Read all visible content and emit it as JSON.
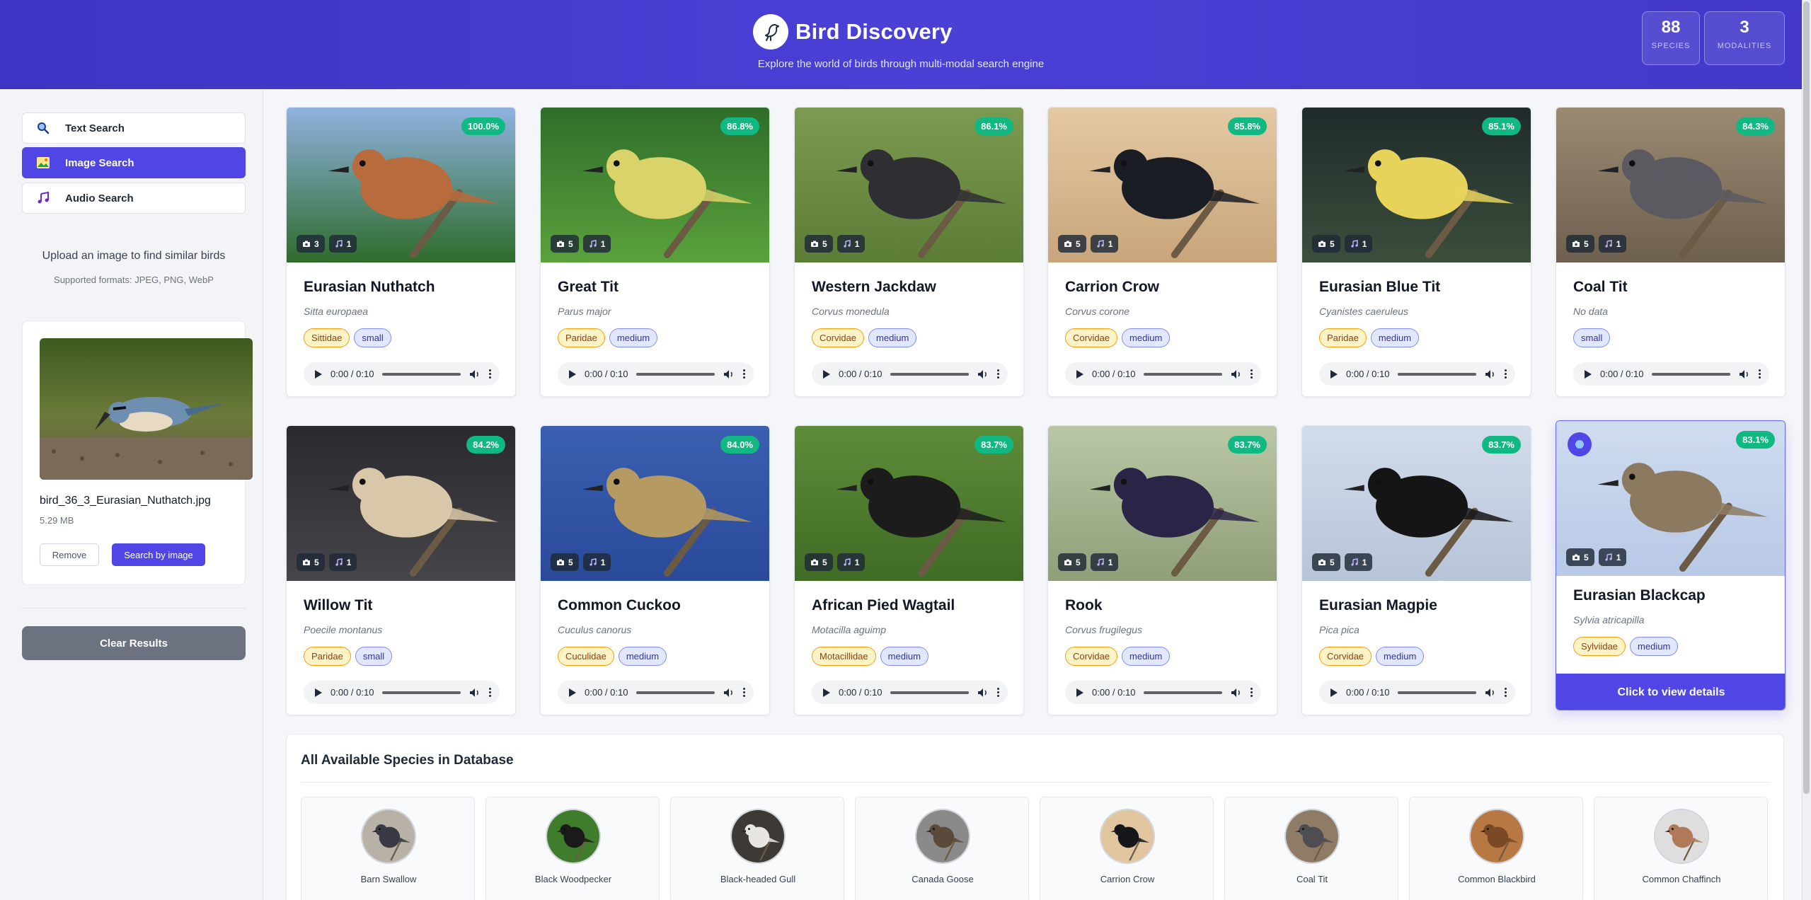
{
  "header": {
    "title": "Bird Discovery",
    "subtitle": "Explore the world of birds through multi-modal search engine",
    "stats": [
      {
        "value": "88",
        "label": "SPECIES"
      },
      {
        "value": "3",
        "label": "MODALITIES"
      }
    ]
  },
  "sidebar": {
    "modes": [
      {
        "label": "Text Search",
        "icon": "search-icon",
        "active": false
      },
      {
        "label": "Image Search",
        "icon": "image-icon",
        "active": true
      },
      {
        "label": "Audio Search",
        "icon": "music-icon",
        "active": false
      }
    ],
    "upload_hint": "Upload an image to find similar birds",
    "upload_formats": "Supported formats: JPEG, PNG, WebP",
    "file": {
      "name": "bird_36_3_Eurasian_Nuthatch.jpg",
      "size": "5.29 MB",
      "remove_label": "Remove",
      "search_label": "Search by image"
    },
    "clear_label": "Clear Results"
  },
  "results": [
    {
      "name": "Eurasian Nuthatch",
      "scientific": "Sitta europaea",
      "score": "100.0%",
      "images": "3",
      "audio": "1",
      "family": "Sittidae",
      "size": "small",
      "time": "0:00 / 0:10",
      "bg": [
        "#8fb3e0",
        "#2e6b2a"
      ],
      "bird": "#b86b3c"
    },
    {
      "name": "Great Tit",
      "scientific": "Parus major",
      "score": "86.8%",
      "images": "5",
      "audio": "1",
      "family": "Paridae",
      "size": "medium",
      "time": "0:00 / 0:10",
      "bg": [
        "#2f6d2a",
        "#5aa23c"
      ],
      "bird": "#d9d36a"
    },
    {
      "name": "Western Jackdaw",
      "scientific": "Corvus monedula",
      "score": "86.1%",
      "images": "5",
      "audio": "1",
      "family": "Corvidae",
      "size": "medium",
      "time": "0:00 / 0:10",
      "bg": [
        "#7c9a52",
        "#5c7d36"
      ],
      "bird": "#2f2f33"
    },
    {
      "name": "Carrion Crow",
      "scientific": "Corvus corone",
      "score": "85.8%",
      "images": "5",
      "audio": "1",
      "family": "Corvidae",
      "size": "medium",
      "time": "0:00 / 0:10",
      "bg": [
        "#e3c9a4",
        "#c9a57a"
      ],
      "bird": "#1b1d24"
    },
    {
      "name": "Eurasian Blue Tit",
      "scientific": "Cyanistes caeruleus",
      "score": "85.1%",
      "images": "5",
      "audio": "1",
      "family": "Paridae",
      "size": "medium",
      "time": "0:00 / 0:10",
      "bg": [
        "#1f2a2a",
        "#3b4f3c"
      ],
      "bird": "#e8d35a"
    },
    {
      "name": "Coal Tit",
      "scientific": "No data",
      "score": "84.3%",
      "images": "5",
      "audio": "1",
      "family": "",
      "size": "small",
      "time": "0:00 / 0:10",
      "bg": [
        "#9a8a72",
        "#6e604e"
      ],
      "bird": "#5a5a60"
    },
    {
      "name": "Willow Tit",
      "scientific": "Poecile montanus",
      "score": "84.2%",
      "images": "5",
      "audio": "1",
      "family": "Paridae",
      "size": "small",
      "time": "0:00 / 0:10",
      "bg": [
        "#2a2a2e",
        "#45454a"
      ],
      "bird": "#d8c7a8"
    },
    {
      "name": "Common Cuckoo",
      "scientific": "Cuculus canorus",
      "score": "84.0%",
      "images": "5",
      "audio": "1",
      "family": "Cuculidae",
      "size": "medium",
      "time": "0:00 / 0:10",
      "bg": [
        "#3b5fb0",
        "#2a4a9a"
      ],
      "bird": "#b59a62"
    },
    {
      "name": "African Pied Wagtail",
      "scientific": "Motacilla aguimp",
      "score": "83.7%",
      "images": "5",
      "audio": "1",
      "family": "Motacillidae",
      "size": "medium",
      "time": "0:00 / 0:10",
      "bg": [
        "#5f8c3a",
        "#3f6b24"
      ],
      "bird": "#1c1c1c"
    },
    {
      "name": "Rook",
      "scientific": "Corvus frugilegus",
      "score": "83.7%",
      "images": "5",
      "audio": "1",
      "family": "Corvidae",
      "size": "medium",
      "time": "0:00 / 0:10",
      "bg": [
        "#b9c7a6",
        "#8f9f78"
      ],
      "bird": "#2a2446"
    },
    {
      "name": "Eurasian Magpie",
      "scientific": "Pica pica",
      "score": "83.7%",
      "images": "5",
      "audio": "1",
      "family": "Corvidae",
      "size": "medium",
      "time": "0:00 / 0:10",
      "bg": [
        "#d2dcea",
        "#b7c4d8"
      ],
      "bird": "#151515"
    },
    {
      "name": "Eurasian Blackcap",
      "scientific": "Sylvia atricapilla",
      "score": "83.1%",
      "images": "5",
      "audio": "1",
      "family": "Sylviidae",
      "size": "medium",
      "time": "",
      "cta": "Click to view details",
      "bg": [
        "#cfdcf0",
        "#b8c9e6"
      ],
      "bird": "#8c7a60"
    }
  ],
  "database": {
    "title": "All Available Species in Database",
    "species": [
      {
        "name": "Barn Swallow",
        "bg": "#b8b2a6",
        "bird": "#3a3a44"
      },
      {
        "name": "Black Woodpecker",
        "bg": "#3f7d2c",
        "bird": "#1a1a1a"
      },
      {
        "name": "Black-headed Gull",
        "bg": "#3d3a36",
        "bird": "#e8e6e0"
      },
      {
        "name": "Canada Goose",
        "bg": "#8a8a8a",
        "bird": "#5b4a3a"
      },
      {
        "name": "Carrion Crow",
        "bg": "#e0c59e",
        "bird": "#15171d"
      },
      {
        "name": "Coal Tit",
        "bg": "#8e7c66",
        "bird": "#4d4d52"
      },
      {
        "name": "Common Blackbird",
        "bg": "#b87844",
        "bird": "#7a4a26"
      },
      {
        "name": "Common Chaffinch",
        "bg": "#dedede",
        "bird": "#b07a5a"
      }
    ]
  }
}
